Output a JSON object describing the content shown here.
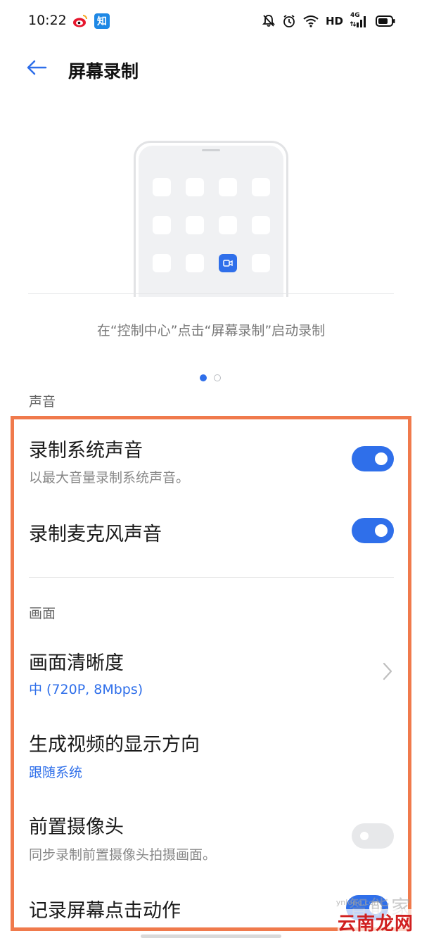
{
  "status_bar": {
    "time": "10:22",
    "network_label": "HD",
    "signal_label": "4G",
    "apps": [
      "weibo-icon",
      "zhihu-icon"
    ],
    "zhihu_label": "知"
  },
  "header": {
    "title": "屏幕录制",
    "back_icon": "arrow-left-icon"
  },
  "illustration": {
    "caption": "在“控制中心”点击“屏幕录制”启动录制",
    "pager": {
      "count": 2,
      "active_index": 0
    }
  },
  "sections": {
    "sound": {
      "label": "声音",
      "record_system_sound": {
        "title": "录制系统声音",
        "subtitle": "以最大音量录制系统声音。",
        "enabled": true
      },
      "record_mic_sound": {
        "title": "录制麦克风声音",
        "enabled": true
      }
    },
    "picture": {
      "label": "画面",
      "clarity": {
        "title": "画面清晰度",
        "value": "中 (720P, 8Mbps)"
      },
      "orientation": {
        "title": "生成视频的显示方向",
        "value": "跟随系统"
      },
      "front_camera": {
        "title": "前置摄像头",
        "subtitle": "同步录制前置摄像头拍摄画面。",
        "enabled": false
      },
      "record_taps": {
        "title": "记录屏幕点击动作",
        "enabled": true
      }
    }
  },
  "watermark": {
    "site_faded": "智能家",
    "site_main": "云南龙网",
    "site_small": "ynlong.com"
  },
  "colors": {
    "accent": "#2f6fea",
    "highlight_frame": "#f07a4c",
    "toggle_off": "#e7e8ea"
  }
}
